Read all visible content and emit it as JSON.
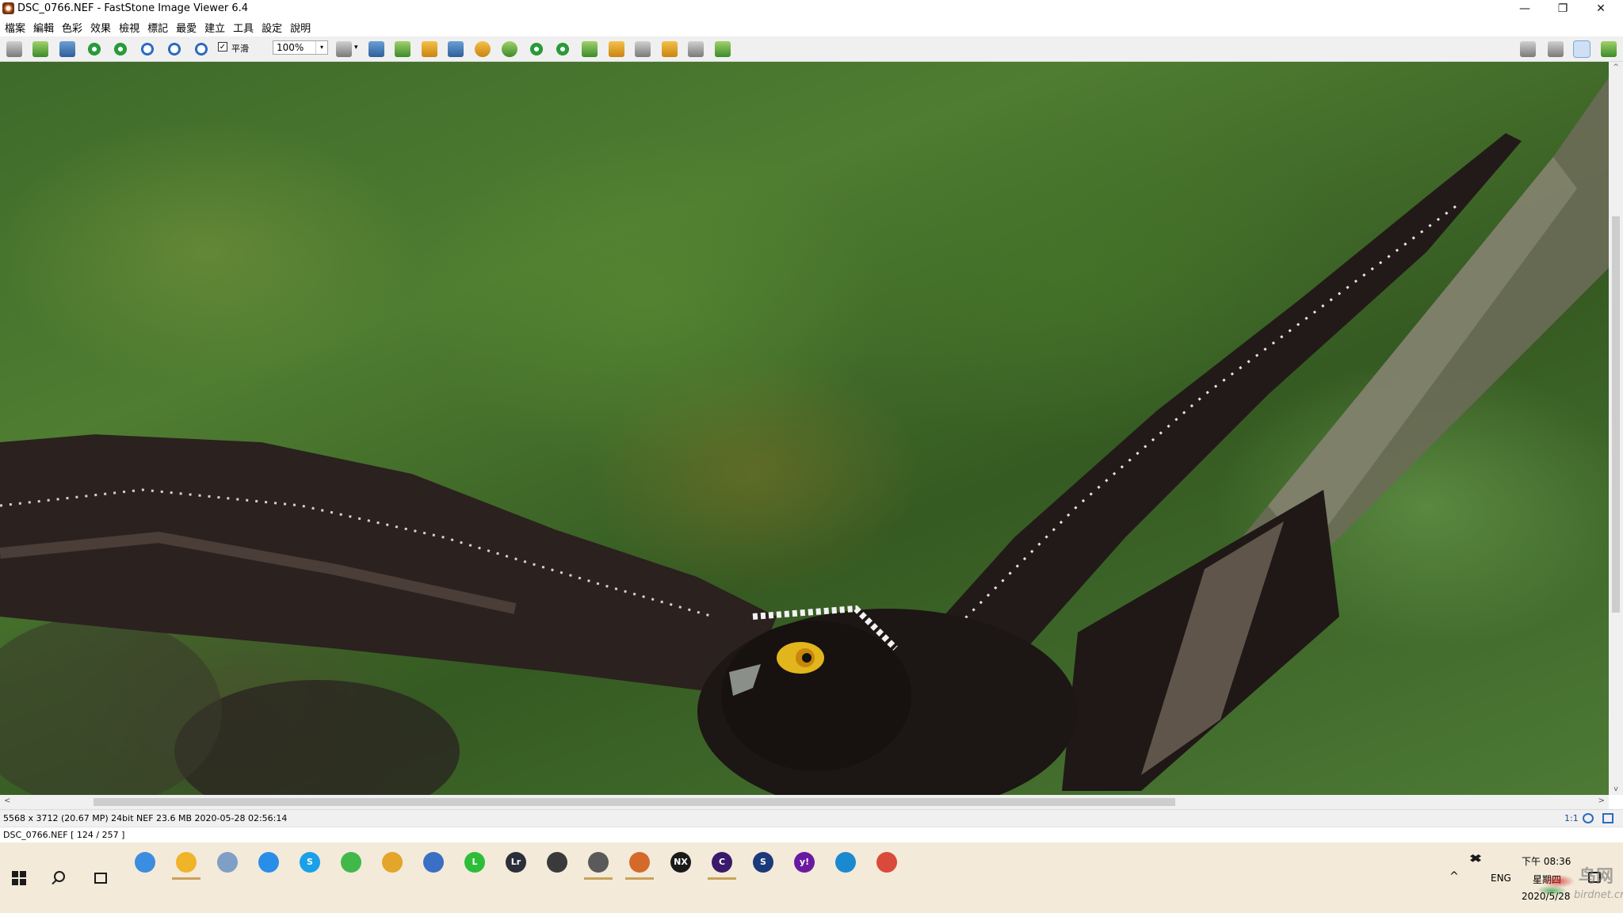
{
  "window": {
    "title": "DSC_0766.NEF  -  FastStone Image Viewer 6.4",
    "minimize_glyph": "—",
    "restore_glyph": "❐",
    "close_glyph": "✕"
  },
  "menu": [
    "檔案",
    "編輯",
    "色彩",
    "效果",
    "檢視",
    "標記",
    "最愛",
    "建立",
    "工具",
    "設定",
    "說明"
  ],
  "toolbar": {
    "smooth_label": "平滑",
    "smooth_checked": true,
    "check_glyph": "✓",
    "zoom_value": "100%",
    "zoom_arrow": "▾",
    "hand_arrow": "▾",
    "icons": [
      "open-icon",
      "browse-icon",
      "save-icon",
      "previous-icon",
      "next-icon",
      "zoom-in-icon",
      "zoom-out-icon",
      "actual-size-icon",
      "hand-tool-icon",
      "resize-icon",
      "crop-icon",
      "adjust-icon",
      "text-icon",
      "color-icon",
      "face-icon",
      "rotate-left-icon",
      "rotate-right-icon",
      "compare-icon",
      "slideshow-icon",
      "wallpaper-icon",
      "email-icon",
      "print-icon",
      "tag-icon"
    ],
    "right_icons": [
      "layout-1-icon",
      "layout-2-icon",
      "layout-active-icon",
      "fullscreen-icon"
    ]
  },
  "scrollbars": {
    "left_arrow": "<",
    "right_arrow": ">",
    "up_arrow": "^",
    "down_arrow": "v"
  },
  "status": {
    "image_info": "5568 x 3712 (20.67 MP)   24bit   NEF    23.6 MB    2020-05-28 02:56:14",
    "zoom_ratio": "1:1",
    "file_position": "DSC_0766.NEF [ 124 / 257 ]"
  },
  "taskbar": {
    "apps": [
      {
        "name": "finder-icon",
        "color": "#3a8de0",
        "label": ""
      },
      {
        "name": "file-explorer-icon",
        "color": "#f0b429",
        "label": ""
      },
      {
        "name": "notepad-icon",
        "color": "#7f9fc7",
        "label": ""
      },
      {
        "name": "onedrive-icon",
        "color": "#2a8ee8",
        "label": ""
      },
      {
        "name": "skype-icon",
        "color": "#1aa0e8",
        "label": "S"
      },
      {
        "name": "wechat-icon",
        "color": "#42b84a",
        "label": ""
      },
      {
        "name": "photo-app-icon",
        "color": "#e3a52a",
        "label": ""
      },
      {
        "name": "browser-globe-icon",
        "color": "#3a6fc5",
        "label": ""
      },
      {
        "name": "line-icon",
        "color": "#2ebd38",
        "label": "L"
      },
      {
        "name": "lightroom-icon",
        "color": "#2a2f3a",
        "label": "Lr"
      },
      {
        "name": "capture-icon",
        "color": "#3a3a3a",
        "label": ""
      },
      {
        "name": "clapper-icon",
        "color": "#5a5a5a",
        "label": ""
      },
      {
        "name": "faststone-icon",
        "color": "#d46a2a",
        "label": ""
      },
      {
        "name": "nx-studio-icon",
        "color": "#1a1a1a",
        "label": "NX"
      },
      {
        "name": "capture-one-icon",
        "color": "#3a1a6a",
        "label": "C"
      },
      {
        "name": "shield-app-icon",
        "color": "#1a3a7a",
        "label": "S"
      },
      {
        "name": "yahoo-icon",
        "color": "#6a1aa0",
        "label": "y!"
      },
      {
        "name": "edge-icon",
        "color": "#1a8ad0",
        "label": ""
      },
      {
        "name": "chrome-icon",
        "color": "#d94a3a",
        "label": ""
      }
    ],
    "tray": {
      "chevron": "^",
      "lang": "ENG",
      "time": "下午 08:36",
      "weekday": "星期四",
      "date": "2020/5/28"
    },
    "watermark_text": "鸟网",
    "watermark_url": "birdnet.cn"
  }
}
